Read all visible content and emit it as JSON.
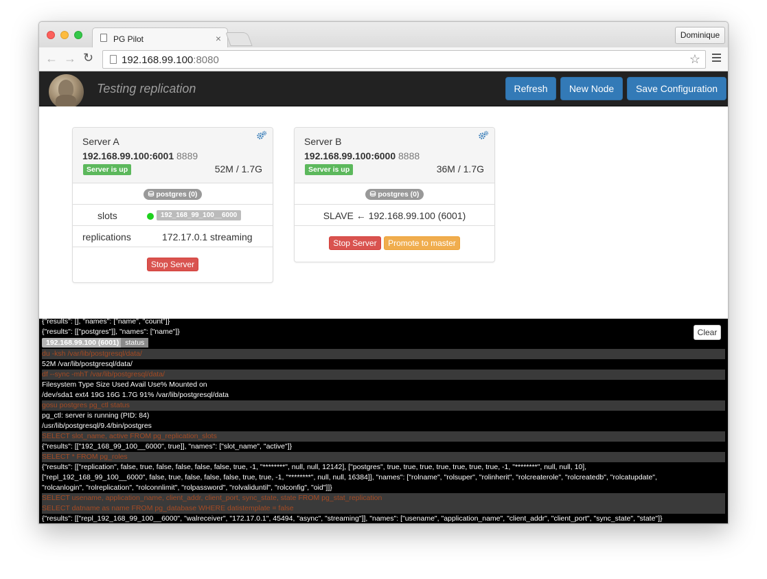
{
  "browser": {
    "tab_title": "PG Pilot",
    "tab_close": "×",
    "profile_name": "Dominique",
    "url_host": "192.168.99.100",
    "url_port": ":8080"
  },
  "app": {
    "title": "Testing replication",
    "buttons": {
      "refresh": "Refresh",
      "new_node": "New Node",
      "save_configuration": "Save Configuration"
    }
  },
  "servers": [
    {
      "name": "Server A",
      "address": "192.168.99.100:6001",
      "port": "8889",
      "status": "Server is up",
      "usage": "52M / 1.7G",
      "database_badge": "postgres (0)",
      "slots_label": "slots",
      "slot_name": "192_168_99_100__6000",
      "replications_label": "replications",
      "replication_value": "172.17.0.1 streaming",
      "stop_label": "Stop Server"
    },
    {
      "name": "Server B",
      "address": "192.168.99.100:6000",
      "port": "8888",
      "status": "Server is up",
      "usage": "36M / 1.7G",
      "database_badge": "postgres (0)",
      "slave_text": "SLAVE ← 192.168.99.100 (6001)",
      "stop_label": "Stop Server",
      "promote_label": "Promote to master"
    }
  ],
  "console": {
    "clear_label": "Clear",
    "header_tag": "192.168.99.100 (6001)",
    "header_status": "status",
    "lines": [
      {
        "kind": "out",
        "text": "{\"results\": [], \"names\": [\"name\", \"count\"]}"
      },
      {
        "kind": "out",
        "text": "{\"results\": [[\"postgres\"]], \"names\": [\"name\"]}"
      },
      {
        "kind": "header"
      },
      {
        "kind": "cmd",
        "text": "du -ksh /var/lib/postgresql/data/"
      },
      {
        "kind": "out",
        "text": "52M /var/lib/postgresql/data/"
      },
      {
        "kind": "cmd",
        "text": "df --sync -mhT /var/lib/postgresql/data/"
      },
      {
        "kind": "out",
        "text": "Filesystem Type Size Used Avail Use% Mounted on"
      },
      {
        "kind": "out",
        "text": "/dev/sda1 ext4 19G 16G 1.7G 91% /var/lib/postgresql/data"
      },
      {
        "kind": "cmd",
        "text": "gosu postgres pg_ctl status"
      },
      {
        "kind": "out",
        "text": "pg_ctl: server is running (PID: 84)"
      },
      {
        "kind": "out",
        "text": "/usr/lib/postgresql/9.4/bin/postgres"
      },
      {
        "kind": "cmd",
        "text": "SELECT slot_name, active FROM pg_replication_slots"
      },
      {
        "kind": "out",
        "text": "{\"results\": [[\"192_168_99_100__6000\", true]], \"names\": [\"slot_name\", \"active\"]}"
      },
      {
        "kind": "cmd",
        "text": "SELECT * FROM pg_roles"
      },
      {
        "kind": "out",
        "text": "{\"results\": [[\"replication\", false, true, false, false, false, false, true, -1, \"********\", null, null, 12142], [\"postgres\", true, true, true, true, true, true, true, -1, \"********\", null, null, 10],"
      },
      {
        "kind": "out",
        "text": "[\"repl_192_168_99_100__6000\", false, true, false, false, false, true, true, -1, \"********\", null, null, 16384]], \"names\": [\"rolname\", \"rolsuper\", \"rolinherit\", \"rolcreaterole\", \"rolcreatedb\", \"rolcatupdate\","
      },
      {
        "kind": "out",
        "text": "\"rolcanlogin\", \"rolreplication\", \"rolconnlimit\", \"rolpassword\", \"rolvaliduntil\", \"rolconfig\", \"oid\"]]}"
      },
      {
        "kind": "cmd",
        "text": "SELECT usename, application_name, client_addr, client_port, sync_state, state FROM pg_stat_replication"
      },
      {
        "kind": "cmd",
        "text": "SELECT datname as name FROM pg_database WHERE datistemplate = false"
      },
      {
        "kind": "out",
        "text": "{\"results\": [[\"repl_192_168_99_100__6000\", \"walreceiver\", \"172.17.0.1\", 45494, \"async\", \"streaming\"]], \"names\": [\"usename\", \"application_name\", \"client_addr\", \"client_port\", \"sync_state\", \"state\"]}"
      },
      {
        "kind": "out",
        "text": "{\"results\": [[\"postgres\"]], \"names\": [\"name\"]}"
      }
    ]
  }
}
